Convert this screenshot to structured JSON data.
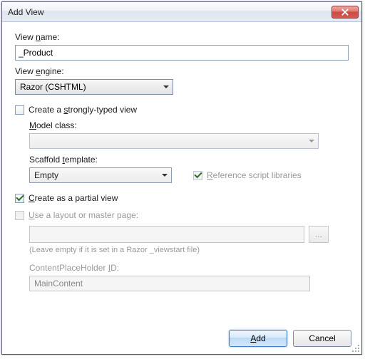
{
  "window": {
    "title": "Add View"
  },
  "labels": {
    "view_name": "View name:",
    "view_name_ul": "n",
    "view_engine": "View engine:",
    "view_engine_ul": "e",
    "strongly_typed": "Create a strongly-typed view",
    "strongly_typed_ul": "s",
    "model_class": "Model class:",
    "model_class_ul": "M",
    "scaffold_template": "Scaffold template:",
    "scaffold_template_ul": "t",
    "reference_libs": "Reference script libraries",
    "reference_libs_ul": "R",
    "partial_view": "Create as a partial view",
    "partial_view_ul": "C",
    "use_layout": "Use a layout or master page:",
    "use_layout_ul": "U",
    "layout_hint": "(Leave empty if it is set in a Razor _viewstart file)",
    "cph_id": "ContentPlaceHolder ID:",
    "cph_id_ul": "I"
  },
  "values": {
    "view_name": "_Product",
    "view_engine": "Razor (CSHTML)",
    "model_class": "",
    "scaffold_template": "Empty",
    "layout_path": "",
    "cph_value": "MainContent"
  },
  "checks": {
    "strongly_typed": false,
    "reference_libs": true,
    "partial_view": true,
    "use_layout": false
  },
  "buttons": {
    "add": "Add",
    "cancel": "Cancel",
    "browse": "..."
  }
}
